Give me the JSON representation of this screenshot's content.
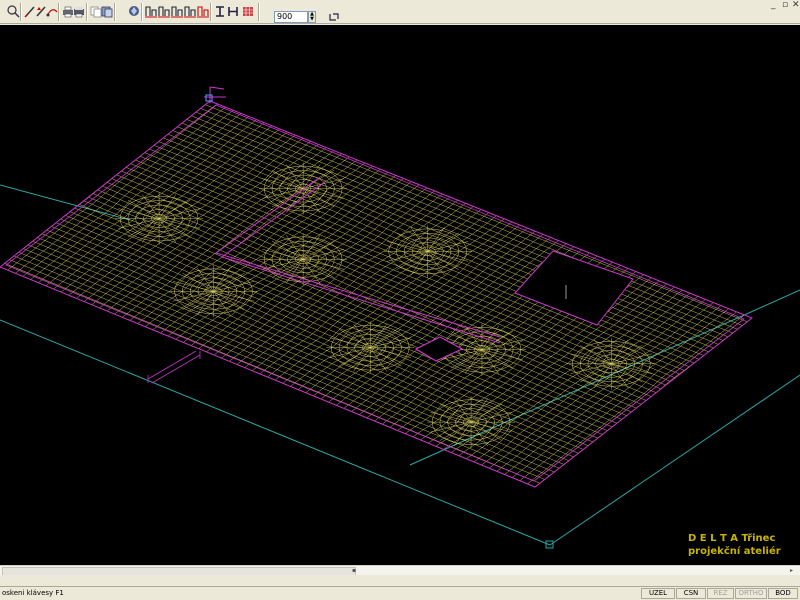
{
  "toolbar": {
    "zoom_value": "900",
    "buttons": [
      {
        "name": "zoom-icon"
      },
      {
        "name": "pencil-icon"
      },
      {
        "name": "pencil-arrow-icon"
      },
      {
        "name": "measure-icon"
      },
      {
        "name": "printer-icon"
      },
      {
        "name": "print-preview-icon"
      },
      {
        "name": "copy-icon"
      },
      {
        "name": "layers-icon"
      },
      {
        "name": "render-icon"
      },
      {
        "name": "section-1-icon"
      },
      {
        "name": "section-2-icon"
      },
      {
        "name": "section-3-icon"
      },
      {
        "name": "section-4-icon"
      },
      {
        "name": "section-5-icon"
      },
      {
        "name": "beam-i-icon"
      },
      {
        "name": "beam-h-icon"
      },
      {
        "name": "grid-icon"
      }
    ]
  },
  "status": {
    "hint": "oskeni klávesy F1",
    "snaps": [
      {
        "label": "UZEL",
        "active": true
      },
      {
        "label": "CSN",
        "active": true
      },
      {
        "label": "REZ",
        "active": false
      },
      {
        "label": "ORTHO",
        "active": false
      },
      {
        "label": "BOD",
        "active": true
      }
    ]
  },
  "watermark": {
    "line1": "D E L T A  Třinec",
    "line2": "projekční ateliér"
  },
  "colors": {
    "mesh": "#e8e06a",
    "outline": "#cc33cc",
    "axis": "#2aa6a6",
    "brand": "#c8b400",
    "viewport": "#000000"
  }
}
